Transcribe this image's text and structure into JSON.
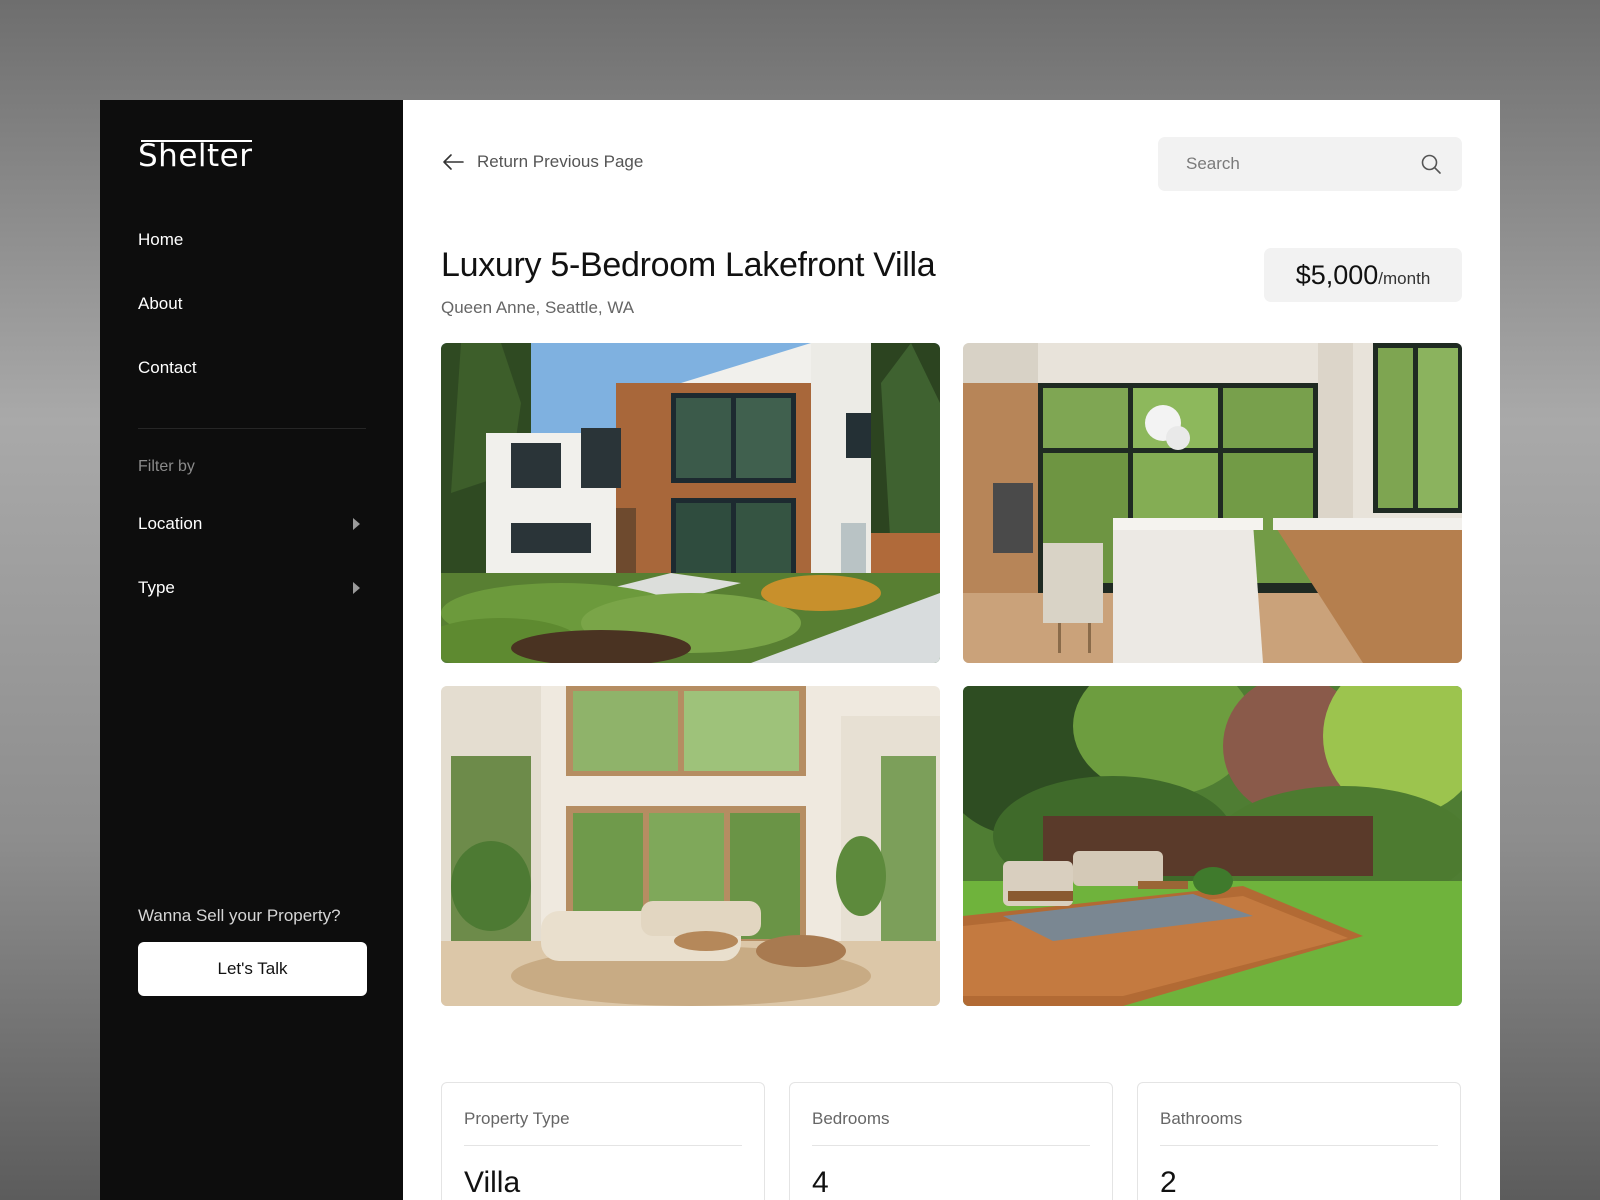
{
  "sidebar": {
    "logo": "Shelter",
    "nav": [
      {
        "label": "Home"
      },
      {
        "label": "About"
      },
      {
        "label": "Contact"
      }
    ],
    "filter_label": "Filter by",
    "filters": [
      {
        "label": "Location"
      },
      {
        "label": "Type"
      }
    ],
    "sell_prompt": "Wanna Sell your Property?",
    "cta_label": "Let's Talk"
  },
  "header": {
    "back_label": "Return Previous Page",
    "search_placeholder": "Search"
  },
  "listing": {
    "title": "Luxury 5-Bedroom Lakefront Villa",
    "location": "Queen Anne, Seattle, WA",
    "price": "$5,000",
    "price_period": "/month"
  },
  "details": [
    {
      "label": "Property Type",
      "value": "Villa"
    },
    {
      "label": "Bedrooms",
      "value": "4"
    },
    {
      "label": "Bathrooms",
      "value": "2"
    }
  ],
  "icons": {
    "back": "arrow-left-icon",
    "search": "search-icon",
    "caret": "caret-right-icon"
  },
  "colors": {
    "sidebar_bg": "#0d0d0d",
    "accent_text": "#111111",
    "muted_text": "#666666",
    "pill_bg": "#f2f2f2"
  }
}
